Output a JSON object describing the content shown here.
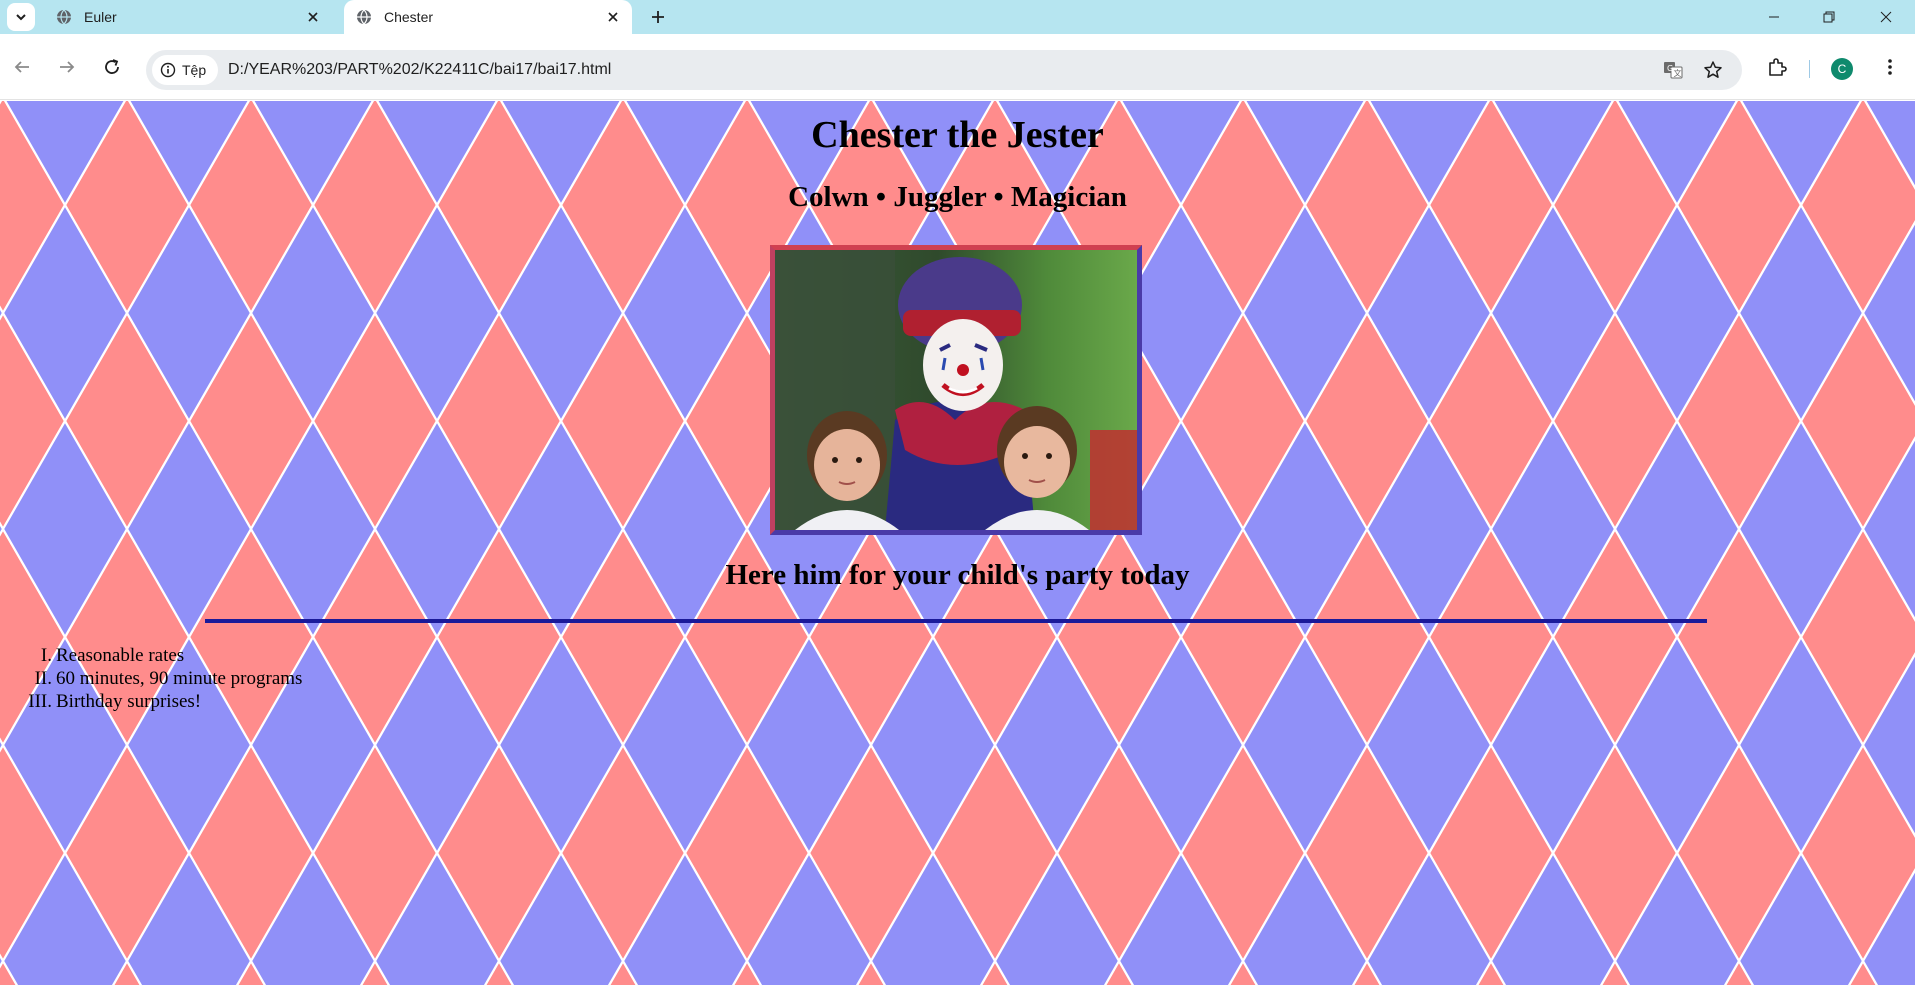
{
  "browser": {
    "tabs": [
      {
        "title": "Euler",
        "active": false
      },
      {
        "title": "Chester",
        "active": true
      }
    ],
    "address": {
      "site_label": "Tệp",
      "url": "D:/YEAR%203/PART%202/K22411C/bai17/bai17.html"
    },
    "profile_initial": "C",
    "profile_color": "#0f8a6d",
    "icons": [
      "tab-search-icon",
      "globe-icon",
      "close-icon",
      "plus-icon",
      "minimize-icon",
      "restore-icon",
      "window-close-icon",
      "back-icon",
      "forward-icon",
      "reload-icon",
      "info-icon",
      "translate-icon",
      "star-icon",
      "extensions-icon",
      "menu-icon"
    ]
  },
  "page": {
    "title": "Chester the Jester",
    "subtitle": "Colwn • Juggler • Magician",
    "tagline": "Here him for your child's party today",
    "features": [
      {
        "num": "I.",
        "text": "Reasonable rates"
      },
      {
        "num": "II.",
        "text": "60 minutes, 90 minute programs"
      },
      {
        "num": "III.",
        "text": "Birthday surprises!"
      }
    ],
    "colors": {
      "diamond_red": "#ff8c8c",
      "diamond_blue": "#9090f8",
      "rule": "#1a1a9a"
    }
  }
}
